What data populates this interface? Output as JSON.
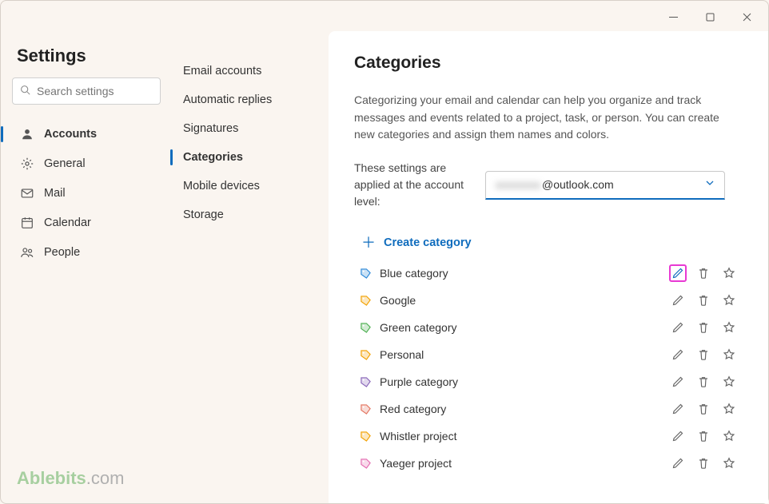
{
  "window": {
    "title": "Settings"
  },
  "sidebar": {
    "heading": "Settings",
    "search_placeholder": "Search settings",
    "nav": [
      {
        "label": "Accounts",
        "active": true,
        "icon": "person"
      },
      {
        "label": "General",
        "active": false,
        "icon": "gear"
      },
      {
        "label": "Mail",
        "active": false,
        "icon": "mail"
      },
      {
        "label": "Calendar",
        "active": false,
        "icon": "calendar"
      },
      {
        "label": "People",
        "active": false,
        "icon": "people"
      }
    ],
    "watermark_brand": "Ablebits",
    "watermark_suffix": ".com"
  },
  "subnav": {
    "items": [
      {
        "label": "Email accounts",
        "active": false
      },
      {
        "label": "Automatic replies",
        "active": false
      },
      {
        "label": "Signatures",
        "active": false
      },
      {
        "label": "Categories",
        "active": true
      },
      {
        "label": "Mobile devices",
        "active": false
      },
      {
        "label": "Storage",
        "active": false
      }
    ]
  },
  "main": {
    "heading": "Categories",
    "description": "Categorizing your email and calendar can help you organize and track messages and events related to a project, task, or person. You can create new categories and assign them names and colors.",
    "account_label": "These settings are applied at the account level:",
    "account_value_suffix": "@outlook.com",
    "create_label": "Create category",
    "categories": [
      {
        "name": "Blue category",
        "color": "#2b88d8",
        "highlighted_edit": true
      },
      {
        "name": "Google",
        "color": "#f2a100",
        "highlighted_edit": false
      },
      {
        "name": "Green category",
        "color": "#4caf50",
        "highlighted_edit": false
      },
      {
        "name": "Personal",
        "color": "#f2a100",
        "highlighted_edit": false
      },
      {
        "name": "Purple category",
        "color": "#8764b8",
        "highlighted_edit": false
      },
      {
        "name": "Red category",
        "color": "#e3735e",
        "highlighted_edit": false
      },
      {
        "name": "Whistler project",
        "color": "#f2a100",
        "highlighted_edit": false
      },
      {
        "name": "Yaeger project",
        "color": "#e36bb0",
        "highlighted_edit": false
      }
    ]
  }
}
